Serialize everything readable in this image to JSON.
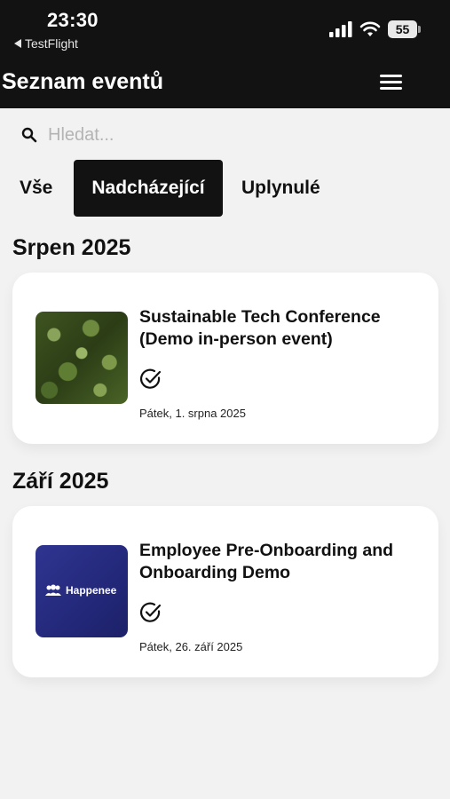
{
  "status_bar": {
    "time": "23:30",
    "back_app": "TestFlight",
    "battery": "55"
  },
  "header": {
    "title": "Seznam eventů"
  },
  "search": {
    "placeholder": "Hledat..."
  },
  "tabs": [
    {
      "label": "Vše",
      "active": false
    },
    {
      "label": "Nadcházející",
      "active": true
    },
    {
      "label": "Uplynulé",
      "active": false
    }
  ],
  "groups": [
    {
      "month": "Srpen 2025",
      "events": [
        {
          "title": "Sustainable Tech Conference (Demo in-person event)",
          "date": "Pátek, 1. srpna 2025",
          "thumbnail": "forest-photo"
        }
      ]
    },
    {
      "month": "Září 2025",
      "events": [
        {
          "title": "Employee Pre-Onboarding and Onboarding Demo",
          "date": "Pátek, 26. září 2025",
          "thumbnail": "happenee-logo",
          "thumbnail_text": "Happenee"
        }
      ]
    }
  ],
  "colors": {
    "header_bg": "#121212",
    "page_bg": "#f2f2f2",
    "card_bg": "#ffffff",
    "active_tab_bg": "#121212",
    "happenee_bg": "#2f3590"
  }
}
